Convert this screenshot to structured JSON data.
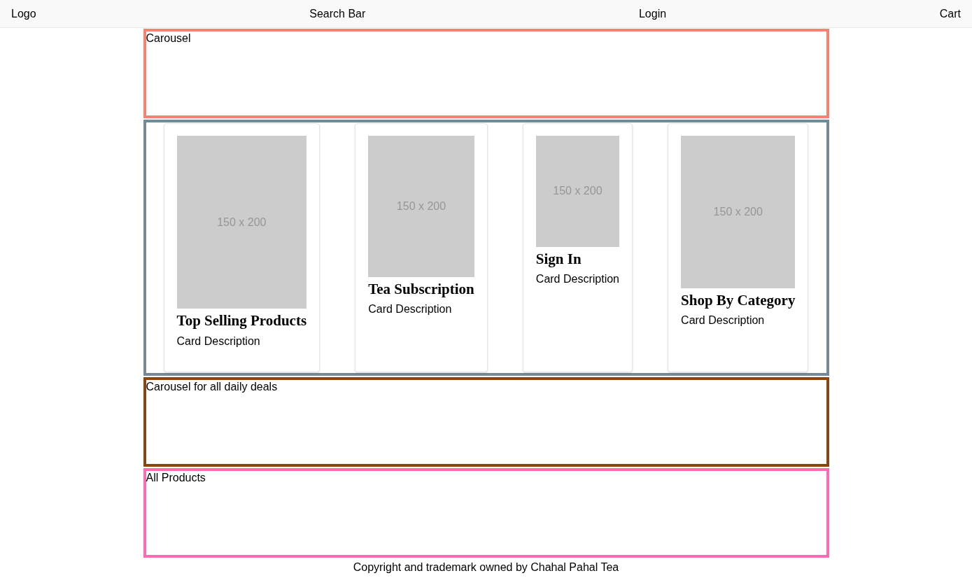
{
  "header": {
    "items": [
      "Logo",
      "Search Bar",
      "Login",
      "Cart"
    ]
  },
  "sections": [
    {
      "kind": "banner",
      "label": "Carousel",
      "color": "#fa8072"
    },
    {
      "kind": "cards",
      "color": "#778899",
      "cards": [
        {
          "image_text": "150 x 200",
          "title": "Top Selling Products",
          "description": "Card Description"
        },
        {
          "image_text": "150 x 200",
          "title": "Tea Subscription",
          "description": "Card Description"
        },
        {
          "image_text": "150 x 200",
          "title": "Sign In",
          "description": "Card Description"
        },
        {
          "image_text": "150 x 200",
          "title": "Shop By Category",
          "description": "Card Description"
        }
      ]
    },
    {
      "kind": "banner",
      "label": "Carousel for all daily deals",
      "color": "#8b4513"
    },
    {
      "kind": "banner",
      "label": "All Products",
      "color": "#ff69b4"
    }
  ],
  "footer": "Copyright and trademark owned by Chahal Pahal Tea"
}
